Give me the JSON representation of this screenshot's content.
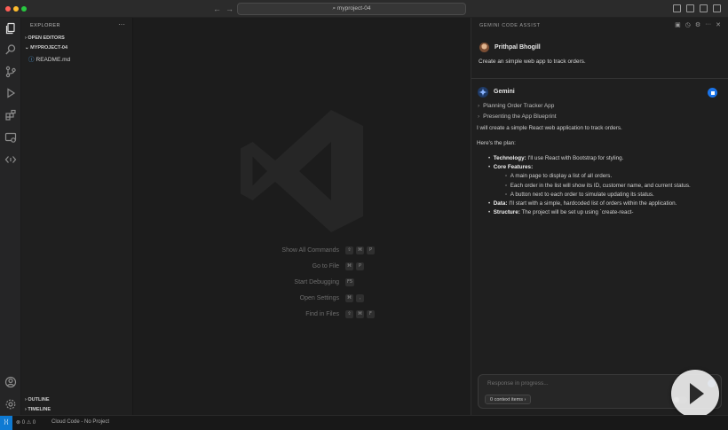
{
  "titlebar": {
    "search_text": "⌕ myproject-04",
    "back": "←",
    "forward": "→"
  },
  "sidebar": {
    "header": "EXPLORER",
    "more": "···",
    "open_editors": "OPEN EDITORS",
    "project": "MYPROJECT-04",
    "file": "README.md",
    "outline": "OUTLINE",
    "timeline": "TIMELINE"
  },
  "editor": {
    "shortcuts": [
      {
        "label": "Show All Commands",
        "keys": [
          "⇧",
          "⌘",
          "P"
        ]
      },
      {
        "label": "Go to File",
        "keys": [
          "⌘",
          "P"
        ]
      },
      {
        "label": "Start Debugging",
        "keys": [
          "F5"
        ]
      },
      {
        "label": "Open Settings",
        "keys": [
          "⌘",
          ","
        ]
      },
      {
        "label": "Find in Files",
        "keys": [
          "⇧",
          "⌘",
          "F"
        ]
      }
    ]
  },
  "chat": {
    "title": "GEMINI CODE ASSIST",
    "user_name": "Prithpal Bhogill",
    "user_message": "Create an simple web app to track orders.",
    "assistant_name": "Gemini",
    "steps": [
      "Planning Order Tracker App",
      "Presenting the App Blueprint"
    ],
    "intro": "I will create a simple React web application to track orders.",
    "plan_heading": "Here's the plan:",
    "bullets": [
      {
        "bold": "Technology:",
        "text": " I'll use React with Bootstrap for styling."
      },
      {
        "bold": "Core Features:",
        "text": ""
      },
      {
        "bold": "",
        "text": "A main page to display a list of all orders."
      },
      {
        "bold": "",
        "text": "Each order in the list will show its ID, customer name, and current status."
      },
      {
        "bold": "",
        "text": "A button next to each order to simulate updating its status."
      },
      {
        "bold": "Data:",
        "text": " I'll start with a simple, hardcoded list of orders within the application."
      },
      {
        "bold": "Structure:",
        "text": " The project will be set up using `create-react-"
      }
    ],
    "input_placeholder": "Response in progress...",
    "context_chip": "0 context items ›"
  },
  "statusbar": {
    "remote": "⟩⟨",
    "problems": "⊗ 0 ⚠ 0",
    "cloud": "Cloud Code - No Project"
  },
  "colors": {
    "accent": "#0e7ad3",
    "gemini_blue": "#1a73e8"
  }
}
